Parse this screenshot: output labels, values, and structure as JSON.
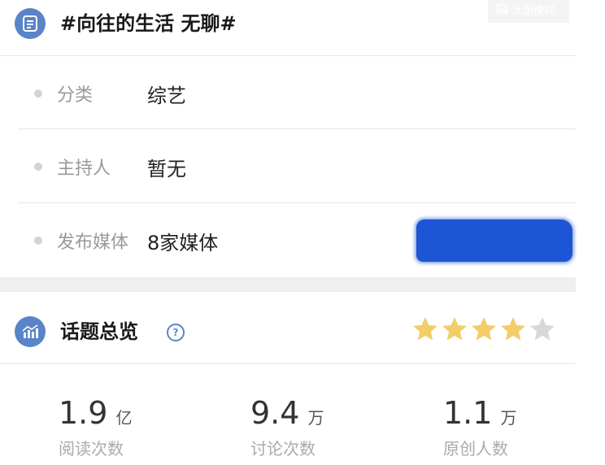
{
  "header": {
    "topic_title": "#向往的生活 无聊#",
    "icon": "list-doc-icon",
    "view_mode_button": "大图模式"
  },
  "info_rows": [
    {
      "label": "分类",
      "value": "综艺"
    },
    {
      "label": "主持人",
      "value": "暂无"
    },
    {
      "label": "发布媒体",
      "value": "8家媒体"
    }
  ],
  "overview": {
    "title": "话题总览",
    "icon": "bar-chart-icon",
    "help_icon": "question-icon",
    "rating": 4,
    "rating_max": 5
  },
  "stats": [
    {
      "value": "1.9",
      "unit": "亿",
      "label": "阅读次数"
    },
    {
      "value": "9.4",
      "unit": "万",
      "label": "讨论次数"
    },
    {
      "value": "1.1",
      "unit": "万",
      "label": "原创人数"
    }
  ],
  "colors": {
    "accent": "#5a84c8",
    "star_filled": "#f2cd6a",
    "star_empty": "#d8d8d8",
    "redaction": "#1d56d4"
  }
}
